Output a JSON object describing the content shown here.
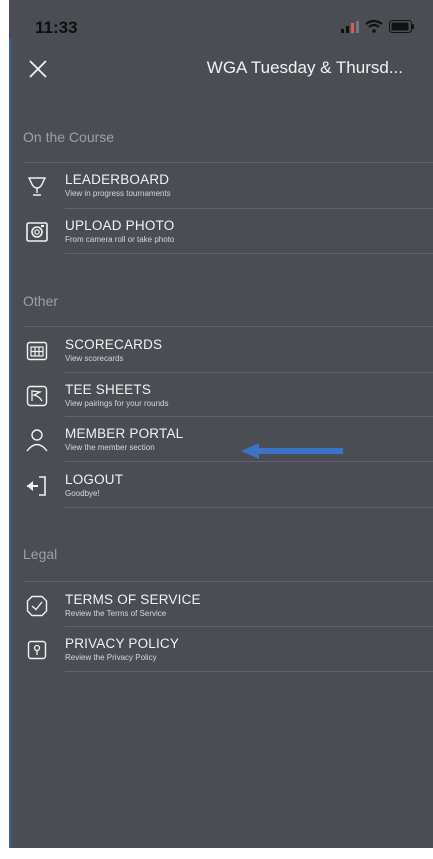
{
  "status_bar": {
    "time": "11:33"
  },
  "header": {
    "title": "WGA Tuesday & Thursd..."
  },
  "colors": {
    "background": "#4a4d53",
    "text": "#f2f2f2",
    "muted": "#9ea0a5",
    "arrow": "#3b73c8"
  },
  "sections": {
    "course": {
      "label": "On the Course",
      "items": [
        {
          "label": "LEADERBOARD",
          "sub": "View in progress tournaments",
          "icon": "trophy-icon"
        },
        {
          "label": "UPLOAD PHOTO",
          "sub": "From camera roll or take photo",
          "icon": "camera-icon"
        }
      ]
    },
    "other": {
      "label": "Other",
      "items": [
        {
          "label": "SCORECARDS",
          "sub": "View scorecards",
          "icon": "scorecard-icon"
        },
        {
          "label": "TEE SHEETS",
          "sub": "View pairings for your rounds",
          "icon": "tee-sheet-icon"
        },
        {
          "label": "MEMBER PORTAL",
          "sub": "View the member section",
          "icon": "person-icon"
        },
        {
          "label": "LOGOUT",
          "sub": "Goodbye!",
          "icon": "logout-icon"
        }
      ]
    },
    "legal": {
      "label": "Legal",
      "items": [
        {
          "label": "TERMS OF SERVICE",
          "sub": "Review the Terms of Service",
          "icon": "terms-icon"
        },
        {
          "label": "PRIVACY POLICY",
          "sub": "Review the Privacy Policy",
          "icon": "privacy-icon"
        }
      ]
    }
  }
}
